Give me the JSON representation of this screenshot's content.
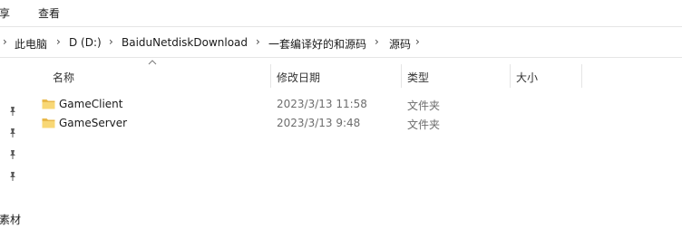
{
  "menu": {
    "share_label": "享",
    "view_label": "查看"
  },
  "address": {
    "crumbs": [
      "此电脑",
      "D (D:)",
      "BaiduNetdiskDownload",
      "一套编译好的和源码",
      "源码"
    ],
    "separator": "›"
  },
  "columns": {
    "name": "名称",
    "modified": "修改日期",
    "type": "类型",
    "size": "大小"
  },
  "files": [
    {
      "name": "GameClient",
      "modified": "2023/3/13 11:58",
      "type": "文件夹",
      "size": "",
      "icon": "folder-icon"
    },
    {
      "name": "GameServer",
      "modified": "2023/3/13 9:48",
      "type": "文件夹",
      "size": "",
      "icon": "folder-icon"
    }
  ],
  "nav": {
    "partial_label": "素材"
  },
  "colors": {
    "folder": "#f8d775",
    "folder_dark": "#e8b84a",
    "divider": "#e5e5e5",
    "muted_text": "#6d6d6d"
  }
}
